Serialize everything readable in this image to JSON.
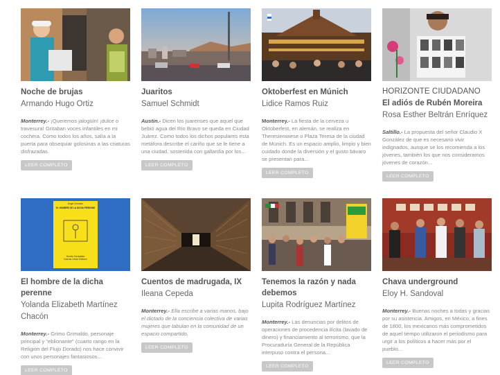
{
  "articles": [
    {
      "kicker": "",
      "title": "Noche de brujas",
      "author": "Armando Hugo Ortiz",
      "place": "Monterrey.-",
      "excerpt": " ¡Queremos jalogüín! ¡dulce o travesura! Gritaban voces infantiles en mi cochera. Como todos los años, salía a la puerta para obsequiar golosinas a las criaturas disfrazadas.",
      "button": "LEER COMPLETO"
    },
    {
      "kicker": "",
      "title": "Juaritos",
      "author": "Samuel Schmidt",
      "place": "Austin.-",
      "excerpt": " Dicen los juarenses que aquel que bebió agua del Río Bravo se queda en Ciudad Juárez. Como todos los dichos populares esta metáfora describe el cariño que se le tiene a una ciudad, sostenida con gallardía por los...",
      "button": "LEER COMPLETO"
    },
    {
      "kicker": "",
      "title": "Oktoberfest en Múnich",
      "author": "Lidice Ramos Ruiz",
      "place": "Monterrey.-",
      "excerpt": " La fiesta de la cerveza u Oktoberfest, en alemán, se realiza en Theresienwiese o Plaza Teresa de la ciudad de Múnich. Es un espacio amplio, limpio y bien cuidado donde la diversión y el gusto bávaro se presentan para...",
      "button": "LEER COMPLETO"
    },
    {
      "kicker": "HORIZONTE CIUDADANO",
      "title": "El adiós de Rubén Moreira",
      "author": "Rosa Esther Beltrán Enríquez",
      "place": "Saltillo.-",
      "excerpt": " La propuesta del señor Claudio X González de que es necesario vivir indignados, aunque se los recomienda a los jóvenes, también los que nos consideramos jóvenes de corazón...",
      "button": "LEER COMPLETO"
    },
    {
      "kicker": "",
      "title": "El hombre de la dicha perenne",
      "author": "Yolanda Elizabeth Martínez Chacón",
      "place": "Monterrey.-",
      "excerpt": " Grimo Grimaldo, personaje principal y \"eblionante\" (cuarto rango en la Religión del Flujo Dorado) nos hace convivir con unos personajes fantasiosos...",
      "button": "LEER COMPLETO"
    },
    {
      "kicker": "",
      "title": "Cuentos de madrugada, IX",
      "author": "Ileana Cepeda",
      "place": "Monterrey.-",
      "excerpt": " Ella escribe a varias manos, bajo el dictado de la conciencia colectiva de varias mujeres que tabulan en la comunidad de un espacio compartido.",
      "button": "LEER COMPLETO"
    },
    {
      "kicker": "",
      "title": "Tenemos la razón y nada debemos",
      "author": "Lupita Rodríguez Martínez",
      "place": "Monterrey.-",
      "excerpt": " Las denuncias por delitos de operaciones de procedencia ilícita (lavado de dinero) y financiamiento al terrorismo, que la Procuraduría General de la República interpuso contra el persona...",
      "button": "LEER COMPLETO"
    },
    {
      "kicker": "",
      "title": "Chava underground",
      "author": "Eloy H. Sandoval",
      "place": "Monterrey.-",
      "excerpt": " Buenas noches a todas y gracias por su asistencia. Amigos, en México, a fines de 1800, los mexicanos más comprometidos de aquel tiempo utilizaron el periodismo para urgir a los políticos a hacer más por el pueblo...",
      "button": "LEER COMPLETO"
    }
  ],
  "book_cover": {
    "line1": "Ángel Grimaldo",
    "line2": "EL HOMBRE DE LA DICHA PERENNE",
    "line3": "Novela Surrealista",
    "line4": "Nuevas Letras Editores"
  }
}
